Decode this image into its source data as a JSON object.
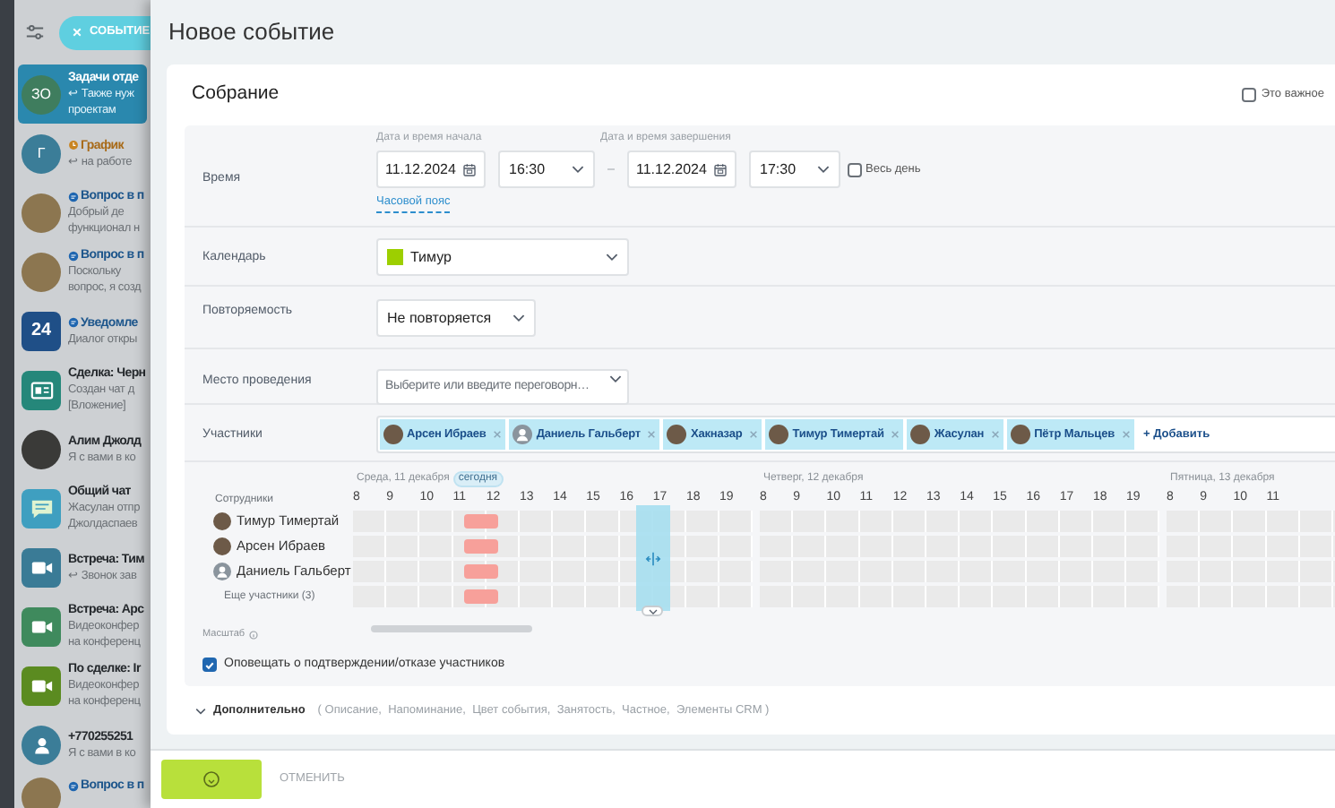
{
  "sidebar": {
    "new_event_button": {
      "label": "СОБЫТИЕ"
    },
    "chats": [
      {
        "kind": "initials",
        "avatar_text": "ЗО",
        "color": "#3f7d5e",
        "title": "Задачи отде",
        "lines": [
          "↩ Также нуж",
          "проектам"
        ],
        "selected": true
      },
      {
        "kind": "initials",
        "avatar_text": "Г",
        "color": "#3b7d98",
        "title": "График",
        "clock_icon": true,
        "lines": [
          "↩ на работе"
        ],
        "selected": false
      },
      {
        "kind": "people",
        "color": "#8c7650",
        "title": "Вопрос в п",
        "bubble_icon": true,
        "lines": [
          "Добрый де",
          "функционал н"
        ],
        "selected": false
      },
      {
        "kind": "people",
        "color": "#8c7650",
        "title": "Вопрос в п",
        "bubble_icon": true,
        "lines": [
          "Поскольку",
          "вопрос, я созд"
        ],
        "selected": false
      },
      {
        "kind": "number",
        "avatar_text": "24",
        "color": "#1f4f87",
        "title": "Уведомле",
        "bubble_icon": true,
        "lines": [
          "Диалог откры"
        ],
        "selected": false
      },
      {
        "kind": "card",
        "color": "#25877a",
        "title": "Сделка: Черн",
        "lines": [
          "Создан чат д",
          "[Вложение]"
        ],
        "selected": false
      },
      {
        "kind": "photo",
        "color": "#3a3a38",
        "title": "Алим Джолд",
        "lines": [
          "Я с вами в ко"
        ],
        "selected": false
      },
      {
        "kind": "chat",
        "color": "#3f9fc0",
        "title": "Общий чат",
        "lines": [
          "Жасулан отпр",
          "Джолдаспаев"
        ],
        "selected": false
      },
      {
        "kind": "video",
        "color": "#3a7b96",
        "title": "Встреча: Тим",
        "lines": [
          "↩ Звонок зав"
        ],
        "selected": false
      },
      {
        "kind": "video",
        "color": "#3f8a5d",
        "title": "Встреча: Арс",
        "lines": [
          "Видеоконфер",
          "на конференц"
        ],
        "selected": false
      },
      {
        "kind": "video",
        "color": "#5b8b20",
        "title": "По сделке: Ir",
        "lines": [
          "Видеоконфер",
          "на конференц"
        ],
        "selected": false
      },
      {
        "kind": "person",
        "color": "#3b7d98",
        "title": "+770255251",
        "lines": [
          "Я с вами в ко"
        ],
        "selected": false
      },
      {
        "kind": "people",
        "color": "#8c7650",
        "title": "Вопрос в п",
        "bubble_icon": true,
        "selected": false
      }
    ]
  },
  "dialog": {
    "title": "Новое событие"
  },
  "event": {
    "name": "Собрание",
    "important": {
      "label": "Это важное",
      "checked": false
    }
  },
  "time": {
    "label": "Время",
    "start_caption": "Дата и время начала",
    "start_date": "11.12.2024",
    "start_time": "16:30",
    "end_caption": "Дата и время завершения",
    "end_date": "11.12.2024",
    "end_time": "17:30",
    "all_day": {
      "label": "Весь день",
      "checked": false
    },
    "timezone_link": "Часовой пояс"
  },
  "calendar": {
    "label": "Календарь",
    "value": "Тимур",
    "color": "#9dcf00"
  },
  "repeat": {
    "label": "Повторяемость",
    "value": "Не повторяется"
  },
  "location": {
    "label": "Место проведения",
    "placeholder": "Выберите или введите переговорн…"
  },
  "participants": {
    "label": "Участники",
    "chips": [
      {
        "name": "Арсен Ибраев",
        "has_photo": true
      },
      {
        "name": "Даниель Гальберт",
        "has_photo": false
      },
      {
        "name": "Хакназар",
        "has_photo": true
      },
      {
        "name": "Тимур Тимертай",
        "has_photo": true
      },
      {
        "name": "Жасулан",
        "has_photo": true
      },
      {
        "name": "Пётр Мальцев",
        "has_photo": true
      }
    ],
    "add_link": "+ Добавить"
  },
  "planner": {
    "employees_caption": "Сотрудники",
    "days": [
      {
        "label": "Среда, 11 декабря",
        "today_badge": "сегодня",
        "hours": [
          "8",
          "9",
          "10",
          "11",
          "12",
          "13",
          "14",
          "15",
          "16",
          "17",
          "18",
          "19"
        ]
      },
      {
        "label": "Четверг, 12 декабря",
        "hours": [
          "8",
          "9",
          "10",
          "11",
          "12",
          "13",
          "14",
          "15",
          "16",
          "17",
          "18",
          "19"
        ]
      },
      {
        "label": "Пятница, 13 декабря",
        "hours": [
          "8",
          "9",
          "10",
          "11"
        ]
      }
    ],
    "rows": [
      {
        "kind": "person",
        "name": "Тимур Тимертай",
        "has_photo": true,
        "busy": true
      },
      {
        "kind": "person",
        "name": "Арсен Ибраев",
        "has_photo": true,
        "busy": true
      },
      {
        "kind": "person",
        "name": "Даниель Гальберт",
        "has_photo": false,
        "busy": true
      },
      {
        "kind": "more",
        "name": "Еще участники (3)",
        "busy": true
      }
    ],
    "scale_label": "Масштаб"
  },
  "notify": {
    "label": "Оповещать о подтверждении/отказе участников",
    "checked": true
  },
  "more": {
    "label": "Дополнительно",
    "hint": "( Описание,  Напоминание,  Цвет события,  Занятость,  Частное,  Элементы CRM )"
  },
  "footer": {
    "save_loading": true,
    "cancel": "ОТМЕНИТЬ"
  }
}
